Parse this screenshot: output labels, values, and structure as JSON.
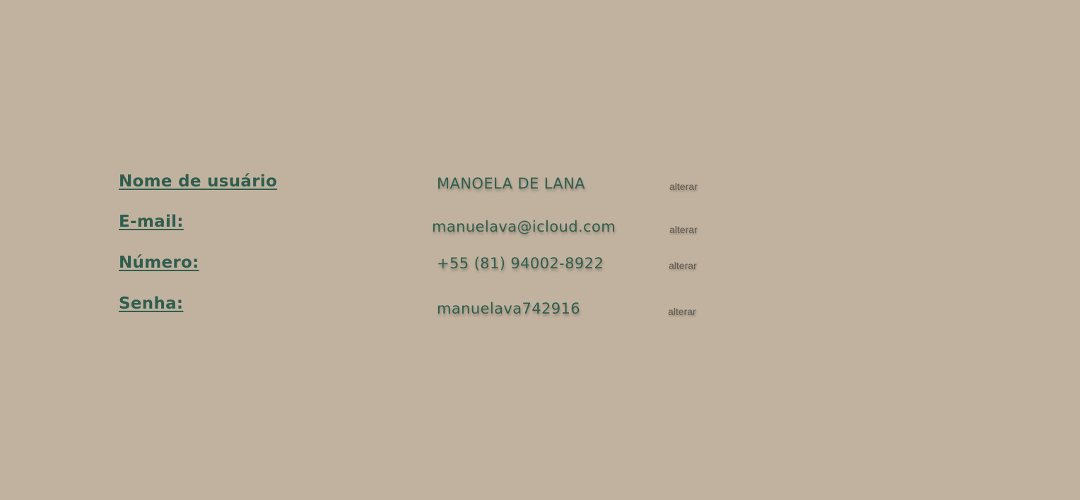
{
  "fields": [
    {
      "label": "Nome de usuário",
      "value": "MANOELA DE LANA",
      "action": "alterar"
    },
    {
      "label": "E-mail:",
      "value": "manuelava@icloud.com",
      "action": "alterar"
    },
    {
      "label": "Número:",
      "value": "+55 (81) 94002-8922",
      "action": "alterar"
    },
    {
      "label": "Senha:",
      "value": "manuelava742916",
      "action": "alterar"
    }
  ],
  "colors": {
    "background": "#c1b29f",
    "accent": "#2f5e4e",
    "link": "#5d5a52"
  }
}
